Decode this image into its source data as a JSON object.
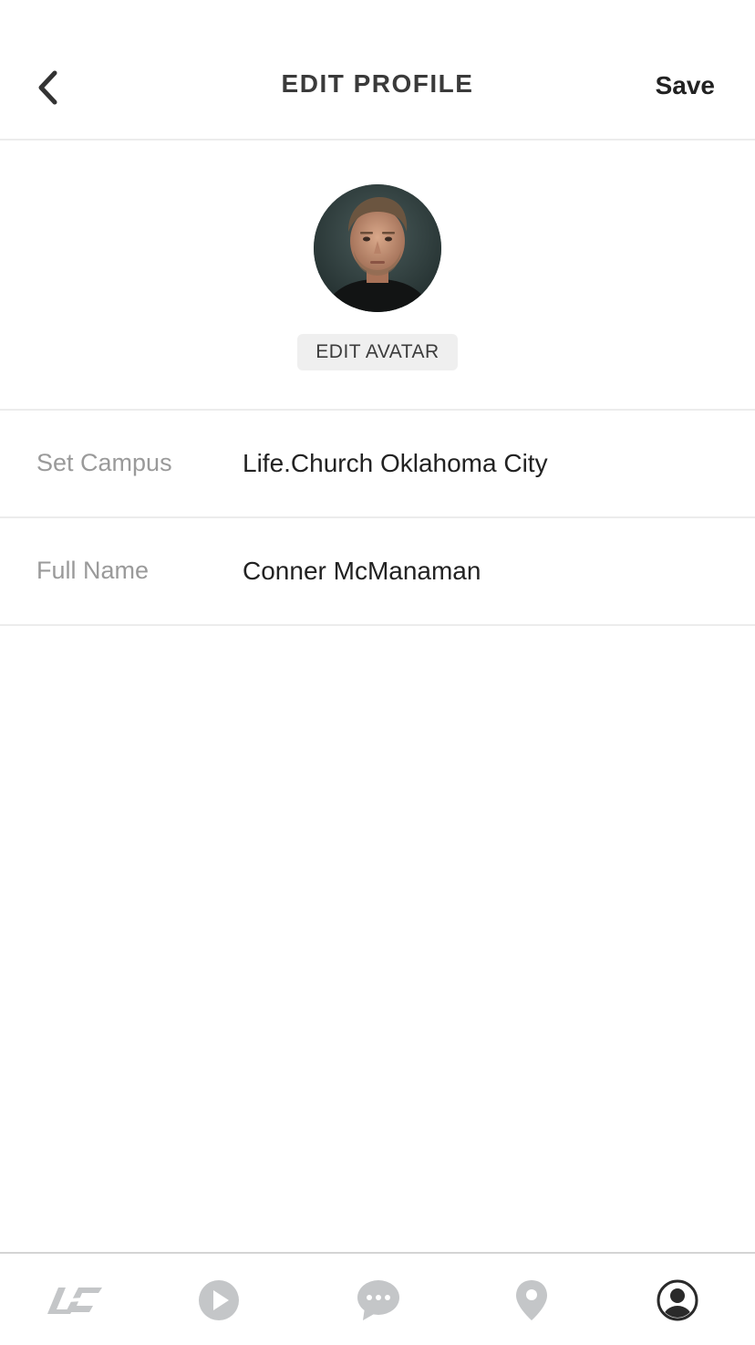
{
  "header": {
    "title": "EDIT PROFILE",
    "save_label": "Save",
    "back_icon": "chevron-left-icon"
  },
  "avatar": {
    "edit_label": "EDIT AVATAR"
  },
  "form": {
    "rows": [
      {
        "label": "Set Campus",
        "value": "Life.Church Oklahoma City"
      },
      {
        "label": "Full Name",
        "value": "Conner McManaman"
      }
    ]
  },
  "tabbar": {
    "tabs": [
      {
        "icon": "lc-logo-icon",
        "active": false
      },
      {
        "icon": "play-icon",
        "active": false
      },
      {
        "icon": "chat-icon",
        "active": false
      },
      {
        "icon": "location-pin-icon",
        "active": false
      },
      {
        "icon": "profile-icon",
        "active": true
      }
    ]
  },
  "colors": {
    "divider": "#ececec",
    "label_gray": "#9a9a9a",
    "inactive_icon": "#c4c6c8",
    "active_icon": "#2a2a2a",
    "button_bg": "#efefef"
  }
}
